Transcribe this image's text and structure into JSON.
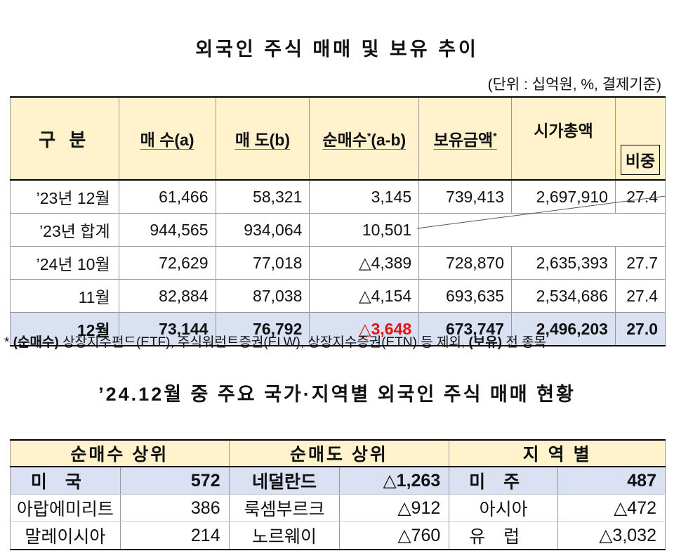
{
  "title1": "외국인 주식 매매 및 보유 추이",
  "unit": "(단위 : 십억원, %, 결제기준)",
  "table1": {
    "headers": {
      "category": "구 분",
      "buy": "매 수(a)",
      "sell": "매 도(b)",
      "net": "순매수",
      "net_mark": "*",
      "net_suffix": "(a-b)",
      "holding": "보유금액",
      "holding_mark": "*",
      "market_cap": "시가총액",
      "ratio": "비중"
    },
    "rows": [
      {
        "label": "’23년 12월",
        "buy": "61,466",
        "sell": "58,321",
        "net": "3,145",
        "holding": "739,413",
        "market_cap": "2,697,910",
        "ratio": "27.4"
      },
      {
        "label": "’23년 합계",
        "buy": "944,565",
        "sell": "934,064",
        "net": "10,501"
      },
      {
        "label": "’24년 10월",
        "buy": "72,629",
        "sell": "77,018",
        "net": "△4,389",
        "holding": "728,870",
        "market_cap": "2,635,393",
        "ratio": "27.7"
      },
      {
        "label": "11월",
        "buy": "82,884",
        "sell": "87,038",
        "net": "△4,154",
        "holding": "693,635",
        "market_cap": "2,534,686",
        "ratio": "27.4"
      },
      {
        "label": "12월",
        "buy": "73,144",
        "sell": "76,792",
        "net": "△3,648",
        "holding": "673,747",
        "market_cap": "2,496,203",
        "ratio": "27.0"
      }
    ]
  },
  "note": {
    "star": "*",
    "bold1": "(순매수)",
    "text1": " 상장지수펀드(ETF), 주식워런트증권(ELW), 상장지수증권(ETN) 등 제외, ",
    "bold2": "(보유)",
    "text2": " 전 종목"
  },
  "title2": "’24.12월 중 주요 국가·지역별 외국인 주식 매매 현황",
  "table2": {
    "headers": {
      "net_buy": "순매수 상위",
      "net_sell": "순매도 상위",
      "region": "지 역 별"
    },
    "rows": [
      {
        "buy_name": "미국",
        "buy_val": "572",
        "sell_name": "네덜란드",
        "sell_val": "△1,263",
        "region_name": "미주",
        "region_val": "487"
      },
      {
        "buy_name": "아랍에미리트",
        "buy_val": "386",
        "sell_name": "룩셈부르크",
        "sell_val": "△912",
        "region_name": "아시아",
        "region_val": "△472"
      },
      {
        "buy_name": "말레이시아",
        "buy_val": "214",
        "sell_name": "노르웨이",
        "sell_val": "△760",
        "region_name": "유럽",
        "region_val": "△3,032"
      }
    ]
  }
}
